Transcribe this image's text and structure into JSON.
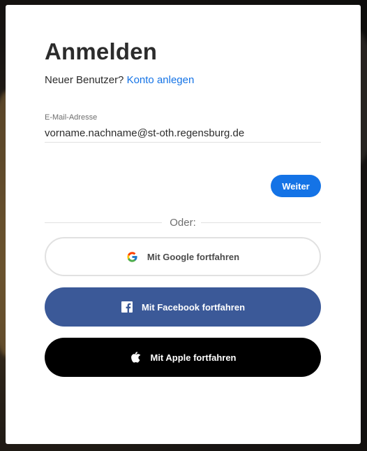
{
  "login": {
    "title": "Anmelden",
    "new_user_text": "Neuer Benutzer?",
    "create_account_link": "Konto anlegen",
    "email_label": "E-Mail-Adresse",
    "email_value": "vorname.nachname@st-oth.regensburg.de",
    "continue_button": "Weiter",
    "divider_text": "Oder:",
    "google_button": "Mit Google fortfahren",
    "facebook_button": "Mit Facebook fortfahren",
    "apple_button": "Mit Apple fortfahren"
  },
  "icons": {
    "google": "google-logo-icon",
    "facebook": "facebook-logo-icon",
    "apple": "apple-logo-icon"
  },
  "colors": {
    "accent": "#1473e6",
    "facebook": "#3b5998",
    "apple": "#000000",
    "text": "#2c2c2c"
  }
}
